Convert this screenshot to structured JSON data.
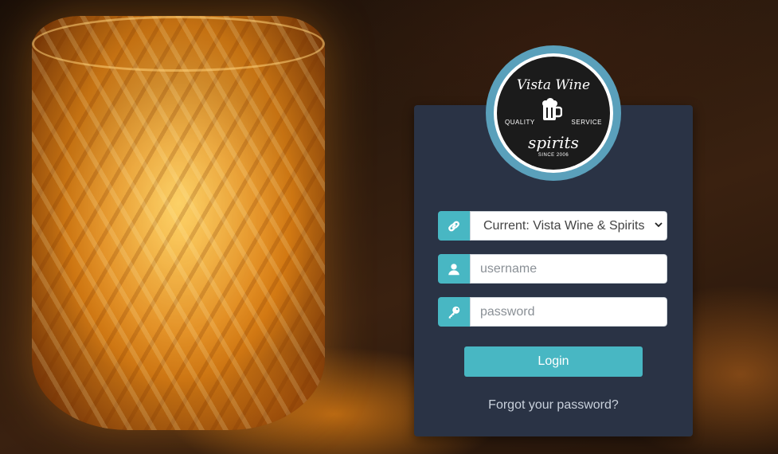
{
  "logo": {
    "top_text": "Vista Wine",
    "left_text": "QUALITY",
    "right_text": "SERVICE",
    "mid_text": "spirits",
    "since_text": "SINCE 2006"
  },
  "store_select": {
    "selected": "Current: Vista Wine & Spirits",
    "icon": "link-icon"
  },
  "username": {
    "placeholder": "username",
    "value": "",
    "icon": "user-icon"
  },
  "password": {
    "placeholder": "password",
    "value": "",
    "icon": "key-icon"
  },
  "login_button": "Login",
  "forgot_link": "Forgot your password?",
  "colors": {
    "panel": "#2a3345",
    "accent": "#48b7c3",
    "logo_ring": "#5aa0bb"
  }
}
